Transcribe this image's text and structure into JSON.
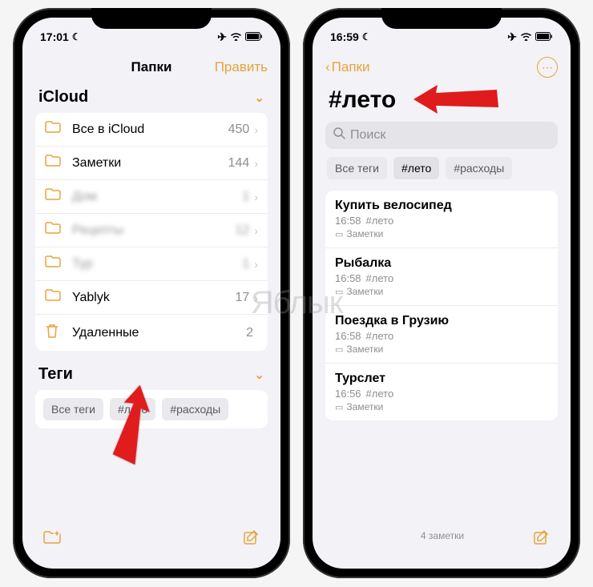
{
  "watermark": "Яблык",
  "left": {
    "status": {
      "time": "17:01"
    },
    "nav": {
      "title": "Папки",
      "edit": "Править"
    },
    "sections": {
      "icloud_header": "iCloud",
      "tags_header": "Теги"
    },
    "folders": [
      {
        "name": "Все в iCloud",
        "count": "450",
        "blur": false,
        "icon": "folder"
      },
      {
        "name": "Заметки",
        "count": "144",
        "blur": false,
        "icon": "folder"
      },
      {
        "name": "Дом",
        "count": "1",
        "blur": true,
        "icon": "folder"
      },
      {
        "name": "Рецепты",
        "count": "12",
        "blur": true,
        "icon": "folder"
      },
      {
        "name": "Тур",
        "count": "1",
        "blur": true,
        "icon": "folder"
      },
      {
        "name": "Yablyk",
        "count": "17",
        "blur": false,
        "icon": "folder"
      },
      {
        "name": "Удаленные",
        "count": "2",
        "blur": false,
        "icon": "trash"
      }
    ],
    "tags": [
      {
        "label": "Все теги"
      },
      {
        "label": "#лето"
      },
      {
        "label": "#расходы"
      }
    ]
  },
  "right": {
    "status": {
      "time": "16:59"
    },
    "nav": {
      "back": "Папки"
    },
    "title": "#лето",
    "search_placeholder": "Поиск",
    "tags": [
      {
        "label": "Все теги",
        "selected": false
      },
      {
        "label": "#лето",
        "selected": true
      },
      {
        "label": "#расходы",
        "selected": false
      }
    ],
    "notes": [
      {
        "title": "Купить велосипед",
        "time": "16:58",
        "tag": "#лето",
        "folder": "Заметки"
      },
      {
        "title": "Рыбалка",
        "time": "16:58",
        "tag": "#лето",
        "folder": "Заметки"
      },
      {
        "title": "Поездка в Грузию",
        "time": "16:58",
        "tag": "#лето",
        "folder": "Заметки"
      },
      {
        "title": "Турслет",
        "time": "16:56",
        "tag": "#лето",
        "folder": "Заметки"
      }
    ],
    "count_label": "4 заметки"
  }
}
